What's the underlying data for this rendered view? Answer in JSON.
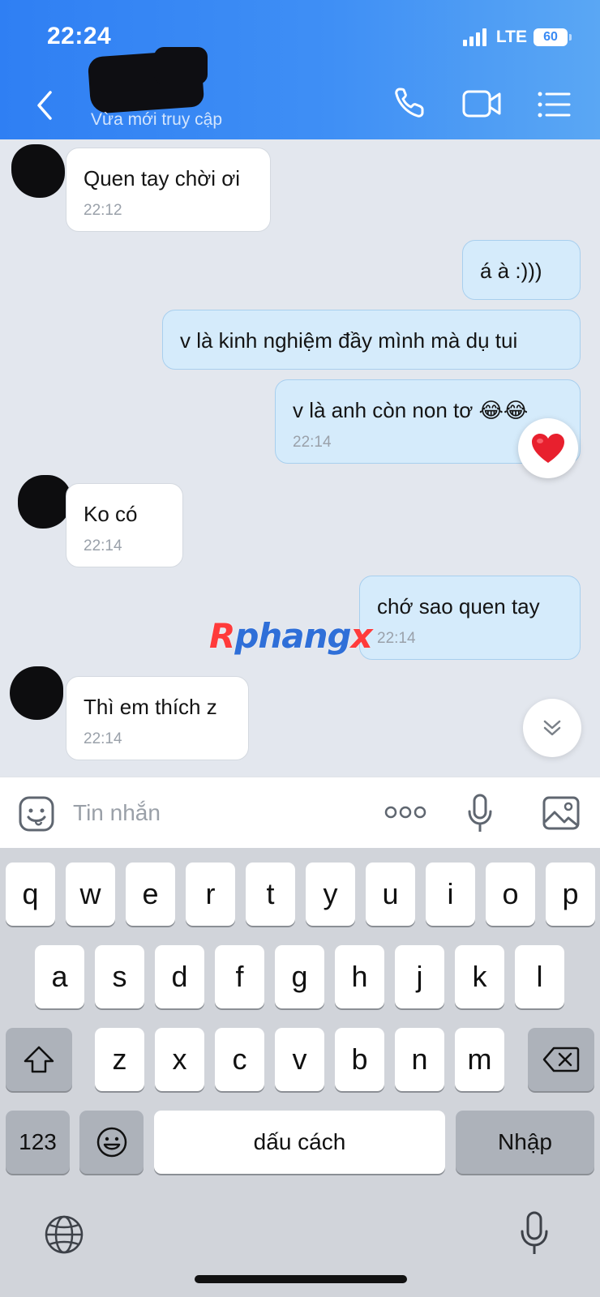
{
  "status_bar": {
    "time": "22:24",
    "network": "LTE",
    "battery": "60"
  },
  "header": {
    "last_seen": "Vừa mới truy cập",
    "icons": [
      "back-icon",
      "phone-icon",
      "video-call-icon",
      "menu-icon"
    ]
  },
  "messages": [
    {
      "side": "in",
      "text": "Quen tay chời ơi",
      "time": "22:12"
    },
    {
      "side": "out",
      "text": "á à :)))",
      "time": ""
    },
    {
      "side": "out",
      "text": "v là kinh nghiệm đầy mình mà dụ tui",
      "time": ""
    },
    {
      "side": "out",
      "text": "v là anh còn non tơ 😂😂",
      "time": "22:14",
      "reaction": "❤️"
    },
    {
      "side": "in",
      "text": "Ko có",
      "time": "22:14"
    },
    {
      "side": "out",
      "text": "chớ sao quen tay",
      "time": "22:14"
    },
    {
      "side": "in",
      "text": "Thì em thích z",
      "time": "22:14"
    }
  ],
  "watermark": {
    "a": "R",
    "b": "phang",
    "c": "x"
  },
  "composer": {
    "placeholder": "Tin nhắn"
  },
  "keyboard": {
    "row1": [
      "q",
      "w",
      "e",
      "r",
      "t",
      "y",
      "u",
      "i",
      "o",
      "p"
    ],
    "row2": [
      "a",
      "s",
      "d",
      "f",
      "g",
      "h",
      "j",
      "k",
      "l"
    ],
    "row3": [
      "z",
      "x",
      "c",
      "v",
      "b",
      "n",
      "m"
    ],
    "numbers": "123",
    "space": "dấu cách",
    "return": "Nhập"
  },
  "colors": {
    "header_start": "#2f7ff3",
    "header_end": "#5aa7f4",
    "outgoing": "#d5ebfb",
    "incoming": "#ffffff"
  }
}
